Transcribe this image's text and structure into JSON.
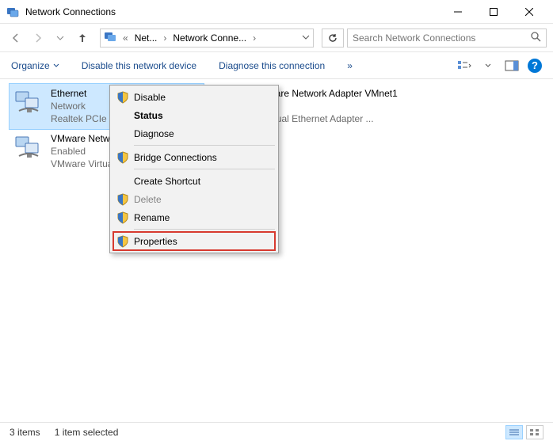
{
  "window": {
    "title": "Network Connections"
  },
  "breadcrumbs": {
    "b1": "Net...",
    "b2": "Network Conne..."
  },
  "search": {
    "placeholder": "Search Network Connections"
  },
  "commands": {
    "organize": "Organize",
    "disable": "Disable this network device",
    "diagnose": "Diagnose this connection",
    "overflow": "»"
  },
  "adapters": [
    {
      "name": "Ethernet",
      "line2": "Network",
      "line3": "Realtek PCIe G"
    },
    {
      "name": "VMware Network Adapter VMnet1",
      "line2": "d",
      "line3": "e Virtual Ethernet Adapter ..."
    },
    {
      "name": "VMware Netw",
      "line2": "Enabled",
      "line3": "VMware Virtua"
    }
  ],
  "context_menu": {
    "disable": "Disable",
    "status": "Status",
    "diagnose": "Diagnose",
    "bridge": "Bridge Connections",
    "shortcut": "Create Shortcut",
    "delete": "Delete",
    "rename": "Rename",
    "properties": "Properties"
  },
  "status": {
    "items": "3 items",
    "selected": "1 item selected"
  }
}
